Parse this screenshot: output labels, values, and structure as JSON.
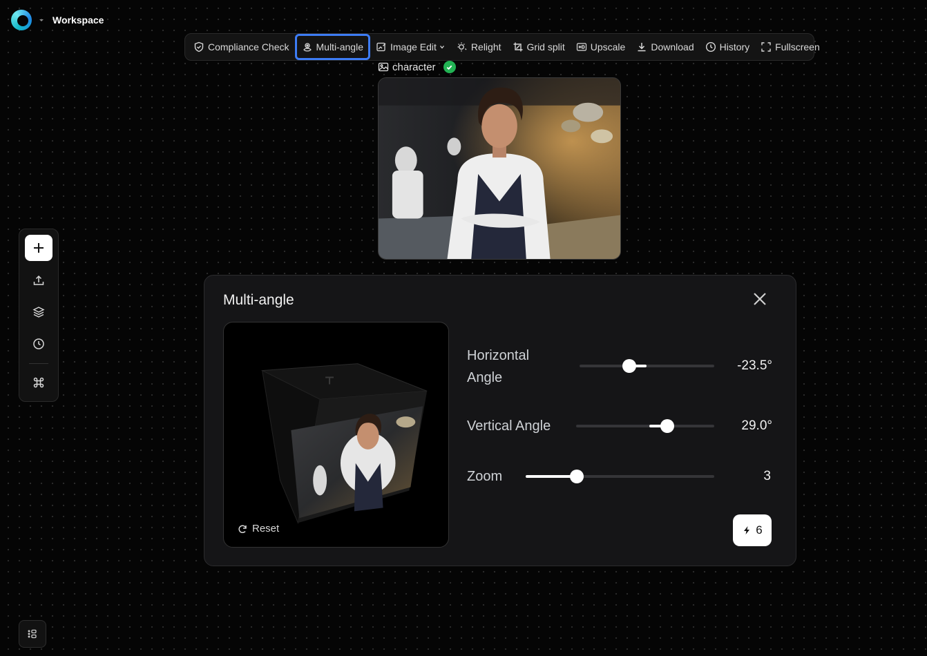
{
  "header": {
    "title": "Workspace"
  },
  "toolbar": {
    "items": [
      {
        "label": "Compliance Check",
        "icon": "shield-icon"
      },
      {
        "label": "Multi-angle",
        "icon": "multi-angle-icon",
        "active": true
      },
      {
        "label": "Image Edit",
        "icon": "image-edit-icon",
        "has_dropdown": true
      },
      {
        "label": "Relight",
        "icon": "relight-icon"
      },
      {
        "label": "Grid split",
        "icon": "crop-icon"
      },
      {
        "label": "Upscale",
        "icon": "hd-icon"
      },
      {
        "label": "Download",
        "icon": "download-icon"
      },
      {
        "label": "History",
        "icon": "clock-icon"
      },
      {
        "label": "Fullscreen",
        "icon": "fullscreen-icon"
      }
    ]
  },
  "node": {
    "label": "character",
    "status": "approved"
  },
  "sidebar": {
    "items": [
      "plus-icon",
      "upload-icon",
      "layers-icon",
      "clock-icon",
      "command-icon"
    ]
  },
  "panel": {
    "title": "Multi-angle",
    "reset_label": "Reset",
    "horizontal": {
      "label": "Horizontal Angle",
      "value": "-23.5°",
      "fraction": 0.37
    },
    "vertical": {
      "label": "Vertical Angle",
      "value": "29.0°",
      "fraction": 0.66
    },
    "zoom": {
      "label": "Zoom",
      "value": "3",
      "fraction": 0.27
    },
    "generate": {
      "cost": "6"
    }
  },
  "colors": {
    "accent": "#3d7cf5",
    "success": "#22b354",
    "background": "#050505",
    "panel": "#151517"
  }
}
